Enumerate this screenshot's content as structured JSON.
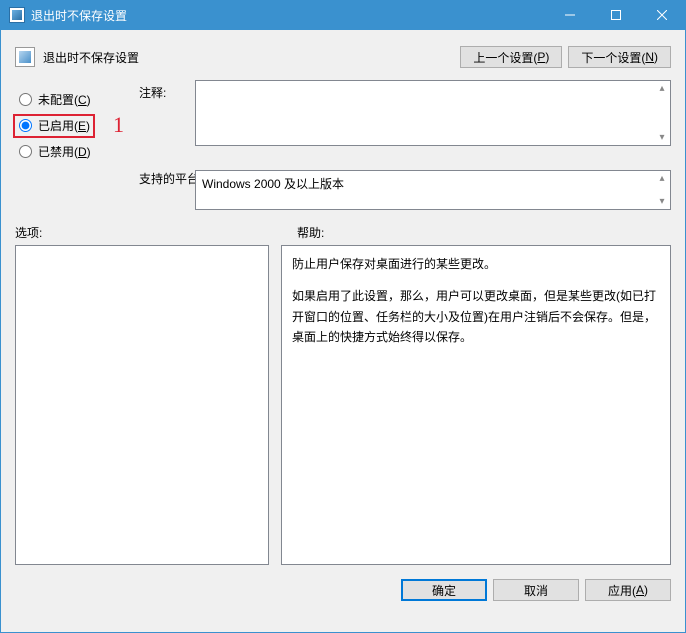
{
  "window": {
    "title": "退出时不保存设置"
  },
  "header": {
    "title": "退出时不保存设置",
    "prev": "上一个设置(",
    "prev_key": "P",
    "next": "下一个设置(",
    "next_key": "N",
    "paren_close": ")"
  },
  "radios": {
    "not_configured": "未配置(",
    "not_configured_key": "C",
    "enabled": "已启用(",
    "enabled_key": "E",
    "disabled": "已禁用(",
    "disabled_key": "D",
    "paren_close": ")"
  },
  "annotation": {
    "number": "1"
  },
  "labels": {
    "comment": "注释:",
    "platform": "支持的平台:",
    "options": "选项:",
    "help": "帮助:"
  },
  "platform": {
    "text": "Windows 2000 及以上版本"
  },
  "help": {
    "p1": "防止用户保存对桌面进行的某些更改。",
    "p2": "如果启用了此设置，那么，用户可以更改桌面，但是某些更改(如已打开窗口的位置、任务栏的大小及位置)在用户注销后不会保存。但是，桌面上的快捷方式始终得以保存。"
  },
  "footer": {
    "ok": "确定",
    "cancel": "取消",
    "apply": "应用(",
    "apply_key": "A",
    "paren_close": ")"
  }
}
